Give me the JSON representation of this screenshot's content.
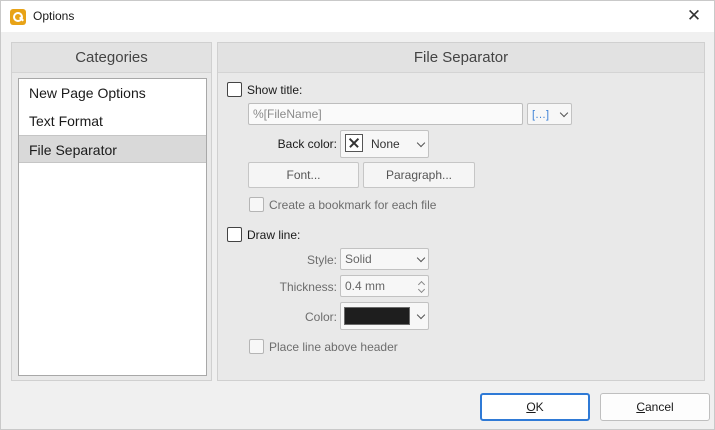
{
  "window": {
    "title": "Options",
    "accent": "#2f7ad6",
    "app_icon": "app-logo-icon"
  },
  "categories": {
    "header": "Categories",
    "items": [
      {
        "label": "New Page Options",
        "selected": false
      },
      {
        "label": "Text Format",
        "selected": false
      },
      {
        "label": "File Separator",
        "selected": true
      }
    ]
  },
  "main": {
    "header": "File Separator",
    "show_title": {
      "label": "Show title:",
      "checked": false
    },
    "title_field": {
      "value": "%[FileName]"
    },
    "macro_button": {
      "icon": "macro-insert-icon",
      "glyph": "[…]"
    },
    "back_color": {
      "label": "Back color:",
      "value": "None"
    },
    "font_button": "Font...",
    "paragraph_button": "Paragraph...",
    "bookmark": {
      "label": "Create a bookmark for each file",
      "checked": false
    },
    "draw_line": {
      "label": "Draw line:",
      "checked": false
    },
    "style": {
      "label": "Style:",
      "value": "Solid"
    },
    "thickness": {
      "label": "Thickness:",
      "value": "0.4 mm"
    },
    "color": {
      "label": "Color:",
      "swatch": "#1e1e1e"
    },
    "line_above": {
      "label": "Place line above header",
      "checked": false
    }
  },
  "footer": {
    "ok": {
      "mnemonic": "O",
      "rest": "K"
    },
    "cancel": {
      "mnemonic": "C",
      "rest": "ancel"
    }
  }
}
